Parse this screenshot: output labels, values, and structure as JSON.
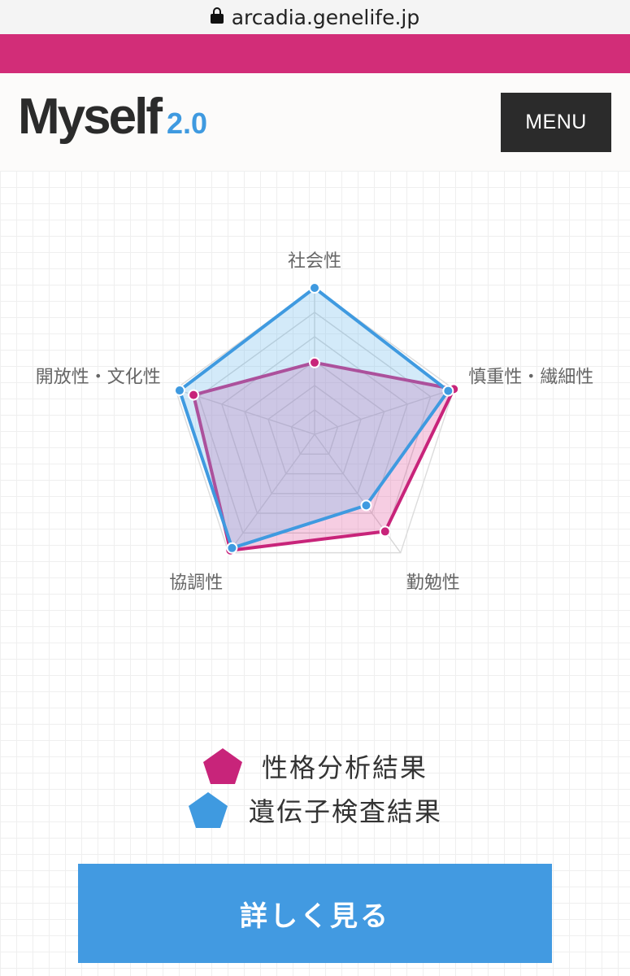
{
  "browser": {
    "url": "arcadia.genelife.jp"
  },
  "header": {
    "logo_main": "Myself",
    "logo_version": "2.0",
    "menu_label": "MENU"
  },
  "colors": {
    "brand_pink": "#d22d78",
    "accent_blue": "#3f9ae0",
    "dark": "#2b2b2b"
  },
  "chart_data": {
    "type": "radar",
    "axes": [
      "社会性",
      "慎重性・繊細性",
      "勤勉性",
      "協調性",
      "開放性・文化性"
    ],
    "range": [
      0,
      1
    ],
    "series": [
      {
        "name": "性格分析結果",
        "color": "#c8247a",
        "values": [
          0.49,
          1.0,
          0.82,
          0.98,
          0.87
        ]
      },
      {
        "name": "遺伝子検査結果",
        "color": "#3f9ae0",
        "values": [
          1.0,
          0.96,
          0.6,
          0.96,
          0.97
        ]
      }
    ],
    "legend_position": "bottom"
  },
  "actions": {
    "details_label": "詳しく見る"
  }
}
